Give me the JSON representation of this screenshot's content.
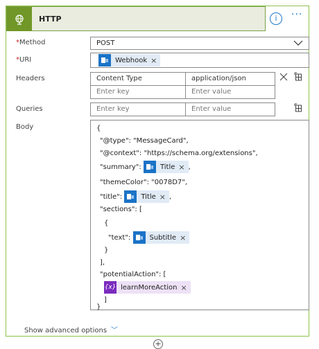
{
  "card": {
    "title": "HTTP",
    "info_label": "i",
    "more_label": "···"
  },
  "method": {
    "label": "Method",
    "required": "*",
    "value": "POST"
  },
  "uri": {
    "label": "URI",
    "required": "*",
    "token": "Webhook"
  },
  "headers": {
    "label": "Headers",
    "key": "Content Type",
    "value": "application/json",
    "key_placeholder": "Enter key",
    "value_placeholder": "Enter value"
  },
  "queries": {
    "label": "Queries",
    "key_placeholder": "Enter key",
    "value_placeholder": "Enter value"
  },
  "body": {
    "label": "Body",
    "lines": {
      "open": "{",
      "type": "\"@type\": \"MessageCard\",",
      "context": "\"@context\": \"https://schema.org/extensions\",",
      "summary_key": "\"summary\":",
      "summary_token": "Title",
      "theme": "\"themeColor\": \"0078D7\",",
      "title_key": "\"title\":",
      "title_token": "Title",
      "sections": "\"sections\": [",
      "obj_open": "{",
      "text_key": "\"text\":",
      "text_token": "Subtitle",
      "obj_close": "}",
      "arr_close": "],",
      "potential": "\"potentialAction\": [",
      "action_token": "learnMoreAction",
      "action_icon": "{x}",
      "pa_close": "]",
      "close": "}",
      "comma": ","
    }
  },
  "advanced": {
    "label": "Show advanced options"
  },
  "add": {
    "label": "+"
  },
  "colors": {
    "accent": "#1e78c8",
    "header_green": "#709727",
    "border_green": "#8cc24a",
    "token_blue": "#1a73c7",
    "token_purple": "#7a2bbf",
    "required": "#c62828"
  }
}
